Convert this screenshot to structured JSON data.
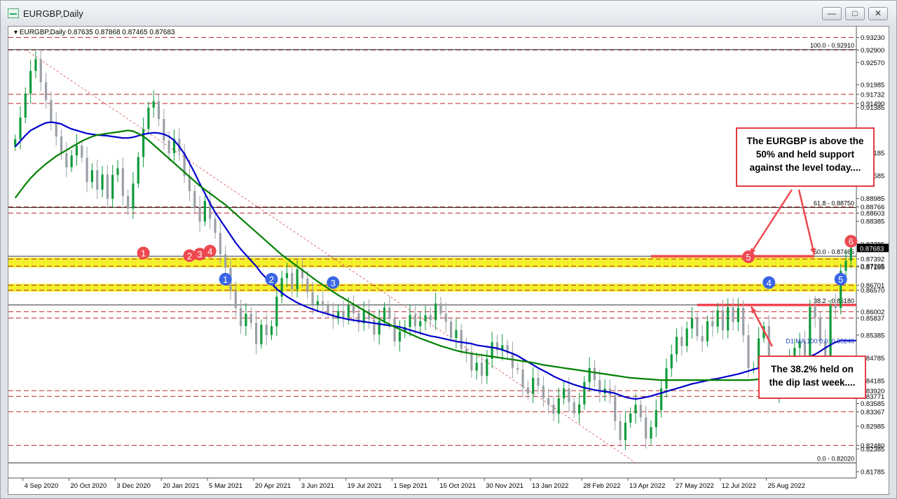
{
  "window": {
    "title": "EURGBP,Daily",
    "minimize_icon": "minimize-icon",
    "maximize_icon": "maximize-icon",
    "close_icon": "close-icon"
  },
  "chart_data": {
    "type": "candlestick",
    "symbol_header": "EURGBP,Daily",
    "ohlc_label": "EURGBP,Daily  0.87635 0.87868 0.87465 0.87683",
    "ohlc": {
      "open": 0.87635,
      "high": 0.87868,
      "low": 0.87465,
      "close": 0.87683
    },
    "ylim": [
      0.8162,
      0.9348
    ],
    "y_ticks": [
      "0.93230",
      "0.92900",
      "0.92570",
      "0.91985",
      "0.91732",
      "0.91490",
      "0.91385",
      "0.90185",
      "0.89585",
      "0.88985",
      "0.88766",
      "0.88603",
      "0.88385",
      "0.87785",
      "0.87392",
      "0.87205",
      "0.87185",
      "0.86701",
      "0.86570",
      "0.86002",
      "0.85837",
      "0.85385",
      "0.84785",
      "0.84185",
      "0.83920",
      "0.83771",
      "0.83585",
      "0.83367",
      "0.82985",
      "0.82480",
      "0.82385",
      "0.81785"
    ],
    "y_tick_values": [
      0.9323,
      0.929,
      0.9257,
      0.91985,
      0.91732,
      0.9149,
      0.91385,
      0.90185,
      0.89585,
      0.88985,
      0.88766,
      0.88603,
      0.88385,
      0.87785,
      0.87392,
      0.87205,
      0.87185,
      0.86701,
      0.8657,
      0.86002,
      0.85837,
      0.85385,
      0.84785,
      0.84185,
      0.8392,
      0.83771,
      0.83585,
      0.83367,
      0.82985,
      0.8248,
      0.82385,
      0.81785
    ],
    "price_badge": {
      "label": "0.87683",
      "value": 0.87683
    },
    "x_ticks": [
      "4 Sep 2020",
      "20 Oct 2020",
      "3 Dec 2020",
      "20 Jan 2021",
      "5 Mar 2021",
      "20 Apr 2021",
      "3 Jun 2021",
      "19 Jul 2021",
      "1 Sep 2021",
      "15 Oct 2021",
      "30 Nov 2021",
      "13 Jan 2022",
      "28 Feb 2022",
      "13 Apr 2022",
      "27 May 2022",
      "12 Jul 2022",
      "25 Aug 2022"
    ],
    "closes": [
      0.9055,
      0.9112,
      0.9175,
      0.9235,
      0.9266,
      0.9205,
      0.9158,
      0.9098,
      0.9062,
      0.9018,
      0.8981,
      0.9012,
      0.9038,
      0.9006,
      0.8942,
      0.8973,
      0.8922,
      0.8962,
      0.8898,
      0.8961,
      0.8978,
      0.8905,
      0.8872,
      0.8938,
      0.9008,
      0.9082,
      0.9138,
      0.9155,
      0.9108,
      0.9051,
      0.9018,
      0.9056,
      0.9022,
      0.8958,
      0.8918,
      0.8875,
      0.8838,
      0.8892,
      0.8845,
      0.8808,
      0.8752,
      0.8716,
      0.8655,
      0.861,
      0.8562,
      0.8595,
      0.8571,
      0.8515,
      0.8566,
      0.8539,
      0.8562,
      0.864,
      0.8689,
      0.8702,
      0.866,
      0.8712,
      0.8688,
      0.8652,
      0.8619,
      0.8628,
      0.8617,
      0.8595,
      0.8582,
      0.8602,
      0.8585,
      0.8617,
      0.8596,
      0.857,
      0.8605,
      0.858,
      0.854,
      0.8576,
      0.8611,
      0.8582,
      0.8522,
      0.8548,
      0.856,
      0.8592,
      0.8562,
      0.8575,
      0.8591,
      0.8578,
      0.8622,
      0.8595,
      0.8574,
      0.8531,
      0.8552,
      0.8502,
      0.8492,
      0.8445,
      0.8466,
      0.8431,
      0.8476,
      0.852,
      0.8498,
      0.8512,
      0.8491,
      0.8452,
      0.8448,
      0.8401,
      0.8384,
      0.8426,
      0.8405,
      0.8372,
      0.8355,
      0.8331,
      0.8372,
      0.8398,
      0.8362,
      0.8332,
      0.8356,
      0.8415,
      0.8452,
      0.842,
      0.8385,
      0.8398,
      0.838,
      0.8312,
      0.8262,
      0.8308,
      0.8332,
      0.8355,
      0.8322,
      0.8266,
      0.8296,
      0.8341,
      0.8398,
      0.8451,
      0.8488,
      0.8534,
      0.851,
      0.8556,
      0.8583,
      0.8536,
      0.8522,
      0.8575,
      0.8561,
      0.8604,
      0.8551,
      0.8612,
      0.8573,
      0.861,
      0.8538,
      0.8452,
      0.8452,
      0.853,
      0.8562,
      0.8425,
      0.8385,
      0.8423,
      0.843,
      0.8475,
      0.8505,
      0.8522,
      0.8456,
      0.8613,
      0.8585,
      0.8523,
      0.8475,
      0.8618,
      0.861,
      0.8708,
      0.8735,
      0.8768
    ],
    "series": [
      {
        "name": "100-day MA",
        "color": "#0000cc",
        "values": [
          0.9035,
          0.905,
          0.9065,
          0.9078,
          0.9085,
          0.9092,
          0.9098,
          0.91,
          0.9098,
          0.9095,
          0.9088,
          0.9082,
          0.9078,
          0.9074,
          0.907,
          0.9068,
          0.9066,
          0.9065,
          0.9064,
          0.9062,
          0.906,
          0.9058,
          0.9058,
          0.906,
          0.9064,
          0.9068,
          0.907,
          0.9072,
          0.9071,
          0.9068,
          0.9062,
          0.9052,
          0.9036,
          0.9016,
          0.8992,
          0.8966,
          0.8938,
          0.8912,
          0.8886,
          0.8862,
          0.8842,
          0.8822,
          0.8802,
          0.8782,
          0.8765,
          0.875,
          0.8735,
          0.872,
          0.8702,
          0.8688,
          0.8674,
          0.866,
          0.865,
          0.864,
          0.8632,
          0.8624,
          0.8618,
          0.8612,
          0.8607,
          0.8602,
          0.8598,
          0.8594,
          0.859,
          0.8586,
          0.8583,
          0.858,
          0.8578,
          0.8576,
          0.8574,
          0.8572,
          0.857,
          0.8568,
          0.8566,
          0.8564,
          0.8562,
          0.856,
          0.8556,
          0.8552,
          0.8548,
          0.8544,
          0.854,
          0.8536,
          0.8534,
          0.8531,
          0.8528,
          0.8525,
          0.8522,
          0.852,
          0.8518,
          0.8516,
          0.8512,
          0.851,
          0.8508,
          0.8506,
          0.8504,
          0.85,
          0.8495,
          0.849,
          0.8484,
          0.8476,
          0.8468,
          0.846,
          0.8452,
          0.8445,
          0.8438,
          0.843,
          0.8424,
          0.8418,
          0.8413,
          0.8408,
          0.8404,
          0.84,
          0.8397,
          0.8394,
          0.8392,
          0.839,
          0.8388,
          0.8385,
          0.838,
          0.8375,
          0.8372,
          0.837,
          0.8372,
          0.8375,
          0.8378,
          0.8382,
          0.8386,
          0.839,
          0.8394,
          0.8398,
          0.8402,
          0.8406,
          0.841,
          0.8413,
          0.8416,
          0.8419,
          0.8422,
          0.8424,
          0.8427,
          0.843,
          0.8433,
          0.8436,
          0.844,
          0.8444,
          0.8448,
          0.8452,
          0.8456,
          0.8459,
          0.8462,
          0.8465,
          0.8467,
          0.8469,
          0.8472,
          0.8475,
          0.8478,
          0.8482,
          0.8488,
          0.8496,
          0.8505,
          0.8513,
          0.852,
          0.8524,
          0.8524,
          0.8524,
          0.8524
        ]
      },
      {
        "name": "200-day MA",
        "color": "#008000",
        "values": [
          0.89,
          0.8918,
          0.8936,
          0.8952,
          0.8966,
          0.8978,
          0.899,
          0.9,
          0.901,
          0.9018,
          0.9026,
          0.9034,
          0.9042,
          0.905,
          0.9056,
          0.9062,
          0.9066,
          0.9068,
          0.907,
          0.9072,
          0.9074,
          0.9076,
          0.9078,
          0.9076,
          0.907,
          0.9062,
          0.9052,
          0.904,
          0.9028,
          0.9016,
          0.9004,
          0.8992,
          0.898,
          0.8968,
          0.8956,
          0.8944,
          0.8932,
          0.8922,
          0.8912,
          0.8902,
          0.8892,
          0.8882,
          0.887,
          0.8858,
          0.8846,
          0.8834,
          0.8822,
          0.881,
          0.8798,
          0.8786,
          0.8774,
          0.8762,
          0.875,
          0.874,
          0.873,
          0.872,
          0.871,
          0.87,
          0.869,
          0.868,
          0.8671,
          0.8662,
          0.8653,
          0.8644,
          0.8636,
          0.8628,
          0.862,
          0.8612,
          0.8604,
          0.8596,
          0.8588,
          0.8581,
          0.8574,
          0.8567,
          0.856,
          0.8554,
          0.8548,
          0.8542,
          0.8536,
          0.853,
          0.8525,
          0.852,
          0.8515,
          0.851,
          0.8506,
          0.8502,
          0.8498,
          0.8495,
          0.8492,
          0.849,
          0.8488,
          0.8486,
          0.8484,
          0.8482,
          0.848,
          0.8478,
          0.8476,
          0.8474,
          0.8472,
          0.847,
          0.8468,
          0.8466,
          0.8463,
          0.846,
          0.8458,
          0.8456,
          0.8454,
          0.8452,
          0.845,
          0.8448,
          0.8446,
          0.8444,
          0.8442,
          0.844,
          0.8438,
          0.8436,
          0.8434,
          0.8432,
          0.843,
          0.8428,
          0.8426,
          0.8425,
          0.8424,
          0.8423,
          0.8422,
          0.8421,
          0.842,
          0.842,
          0.842,
          0.842,
          0.842,
          0.842,
          0.842,
          0.842,
          0.842,
          0.842,
          0.842,
          0.842,
          0.842,
          0.842,
          0.842,
          0.842,
          0.842,
          0.842,
          0.8421,
          0.8422,
          0.8422,
          0.8423,
          0.8424,
          0.8425,
          0.8425,
          0.8426,
          0.8426,
          0.8427,
          0.8428,
          0.8428,
          0.8429,
          0.843,
          0.8432,
          0.8434,
          0.8436,
          0.8438,
          0.844,
          0.8443,
          0.8446,
          0.845
        ]
      }
    ],
    "fib_levels": [
      {
        "label": "100.0 - 0.92910",
        "value": 0.9291
      },
      {
        "label": "61.8 - 0.88750",
        "value": 0.8875
      },
      {
        "label": "50.0 - 0.87465",
        "value": 0.87465
      },
      {
        "label": "38.2 - 0.86180",
        "value": 0.8618
      },
      {
        "label": "0.0 - 0.82020",
        "value": 0.8202
      }
    ],
    "ma_label": "D1 MA:100:0:0: 0.85240",
    "dashed_levels": [
      0.9323,
      0.929,
      0.91732,
      0.9149,
      0.88766,
      0.88603,
      0.87392,
      0.87205,
      0.86701,
      0.8657,
      0.86002,
      0.85837,
      0.8392,
      0.83771,
      0.83367,
      0.8248
    ],
    "zones": [
      {
        "from": 0.87205,
        "to": 0.87392,
        "color": "#f2ef14"
      },
      {
        "from": 0.8657,
        "to": 0.86701,
        "color": "#f2ef14"
      }
    ],
    "red_levels": [
      0.87465,
      0.8618
    ],
    "markers": [
      {
        "label": "1",
        "color": "red",
        "x": 25,
        "y": 0.8755
      },
      {
        "label": "2",
        "color": "red",
        "x": 34,
        "y": 0.8748
      },
      {
        "label": "3",
        "color": "red",
        "x": 36,
        "y": 0.8752
      },
      {
        "label": "4",
        "color": "red",
        "x": 38,
        "y": 0.876
      },
      {
        "label": "1",
        "color": "blue",
        "x": 41,
        "y": 0.8686
      },
      {
        "label": "2",
        "color": "blue",
        "x": 50,
        "y": 0.8686
      },
      {
        "label": "3",
        "color": "blue",
        "x": 62,
        "y": 0.8677
      },
      {
        "label": "5",
        "color": "red",
        "x": 143,
        "y": 0.8745
      },
      {
        "label": "4",
        "color": "blue",
        "x": 147,
        "y": 0.8677
      },
      {
        "label": "5",
        "color": "blue",
        "x": 161,
        "y": 0.8686
      },
      {
        "label": "6",
        "color": "red",
        "x": 163,
        "y": 0.8786
      }
    ],
    "annotations": [
      "The EURGBP is above the 50%  and held support against the level today....",
      "The 38.2% held on the dip last week...."
    ]
  }
}
